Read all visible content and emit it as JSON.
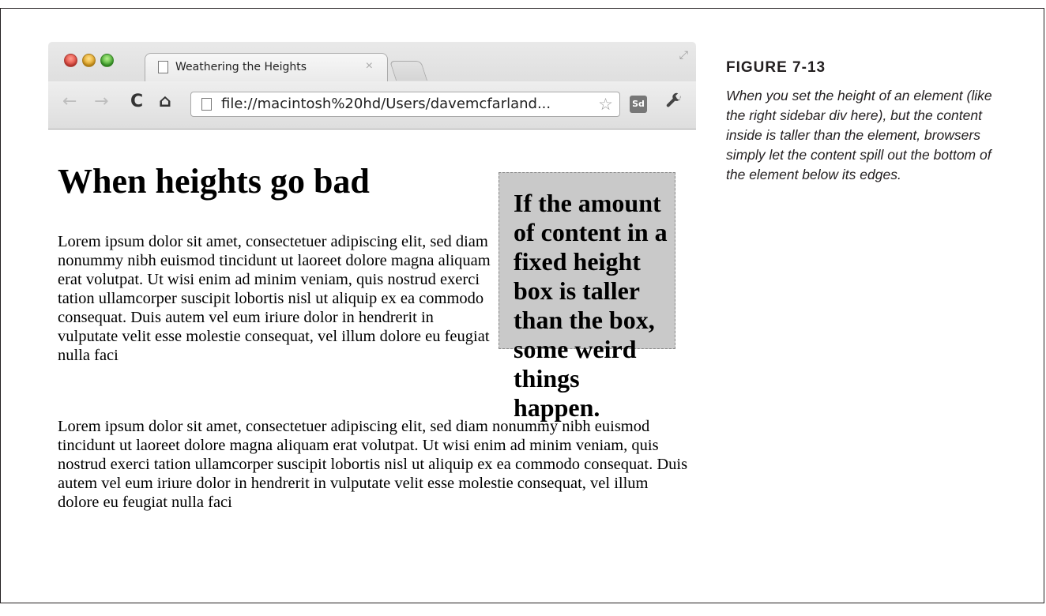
{
  "browser": {
    "tab_title": "Weathering the Heights",
    "tab_close": "×",
    "address": "file://macintosh%20hd/Users/davemcfarland...",
    "extension_badge": "Sd",
    "nav": {
      "back": "←",
      "forward": "→",
      "reload": "C",
      "home": "⌂"
    },
    "star": "☆",
    "wrench": "🔧",
    "expand": "⤢"
  },
  "page": {
    "heading": "When heights go bad",
    "paragraph1": "Lorem ipsum dolor sit amet, consectetuer adipiscing elit, sed diam nonummy nibh euismod tincidunt ut laoreet dolore magna aliquam erat volutpat. Ut wisi enim ad minim veniam, quis nostrud exerci tation ullamcorper suscipit lobortis nisl ut aliquip ex ea commodo consequat. Duis autem vel eum iriure dolor in hendrerit in vulputate velit esse molestie consequat, vel illum dolore eu feugiat nulla faci",
    "paragraph2": "Lorem ipsum dolor sit amet, consectetuer adipiscing elit, sed diam nonummy nibh euismod tincidunt ut laoreet dolore magna aliquam erat volutpat. Ut wisi enim ad minim veniam, quis nostrud exerci tation ullamcorper suscipit lobortis nisl ut aliquip ex ea commodo consequat. Duis autem vel eum iriure dolor in hendrerit in vulputate velit esse molestie consequat, vel illum dolore eu feugiat nulla faci",
    "sidebar_text": "If the amount of content in a fixed height box is taller than the box, some weird things happen."
  },
  "figure": {
    "label": "FIGURE 7-13",
    "caption": "When you set the height of an element (like the right sidebar div here), but the content inside is taller than the element, browsers simply let the content spill out the bottom of the element below its edges."
  }
}
